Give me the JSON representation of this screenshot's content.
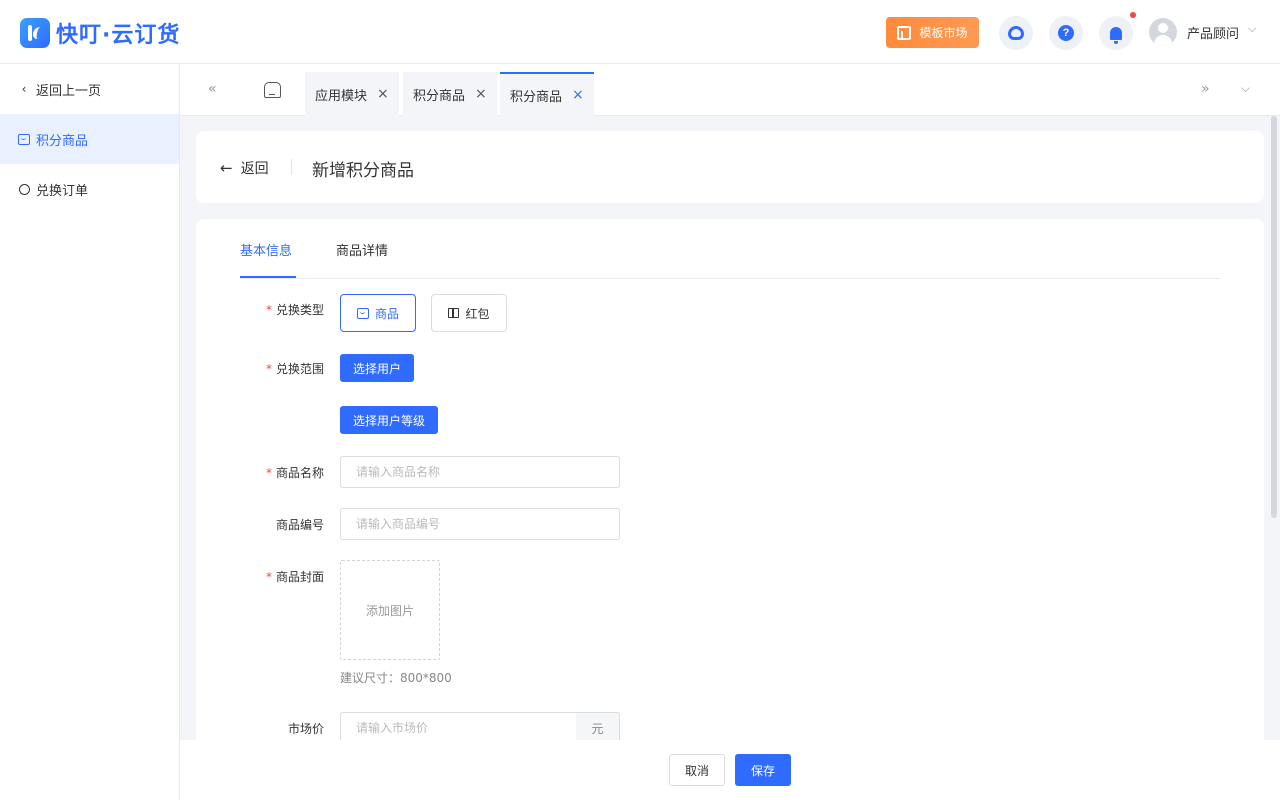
{
  "brand": {
    "name": "快叮·云订货",
    "accent": "#2f6bff"
  },
  "header": {
    "market_label": "模板市场",
    "user_name": "产品顾问",
    "icons": [
      "customer-service-icon",
      "help-icon",
      "bell-icon",
      "avatar",
      "chevron-down-icon"
    ]
  },
  "sidebar": {
    "back_label": "返回上一页",
    "items": [
      {
        "label": "积分商品",
        "icon": "box-icon",
        "active": true
      },
      {
        "label": "兑换订单",
        "icon": "headset-icon",
        "active": false
      }
    ]
  },
  "tabs": {
    "items": [
      {
        "label": "应用模块"
      },
      {
        "label": "积分商品"
      },
      {
        "label": "积分商品",
        "active": true
      }
    ]
  },
  "page": {
    "back_label": "返回",
    "title": "新增积分商品"
  },
  "form": {
    "tabs": [
      "基本信息",
      "商品详情"
    ],
    "exchange_type": {
      "label": "兑换类型",
      "options": [
        "商品",
        "红包"
      ],
      "selected": "商品"
    },
    "exchange_scope": {
      "label": "兑换范围",
      "select_users": "选择用户",
      "select_levels": "选择用户等级"
    },
    "name": {
      "label": "商品名称",
      "placeholder": "请输入商品名称",
      "value": ""
    },
    "code": {
      "label": "商品编号",
      "placeholder": "请输入商品编号",
      "value": ""
    },
    "cover": {
      "label": "商品封面",
      "upload_label": "添加图片",
      "hint": "建议尺寸：800*800"
    },
    "market_price": {
      "label": "市场价",
      "placeholder": "请输入市场价",
      "unit": "元",
      "value": ""
    }
  },
  "footer": {
    "cancel_label": "取消",
    "save_label": "保存"
  }
}
